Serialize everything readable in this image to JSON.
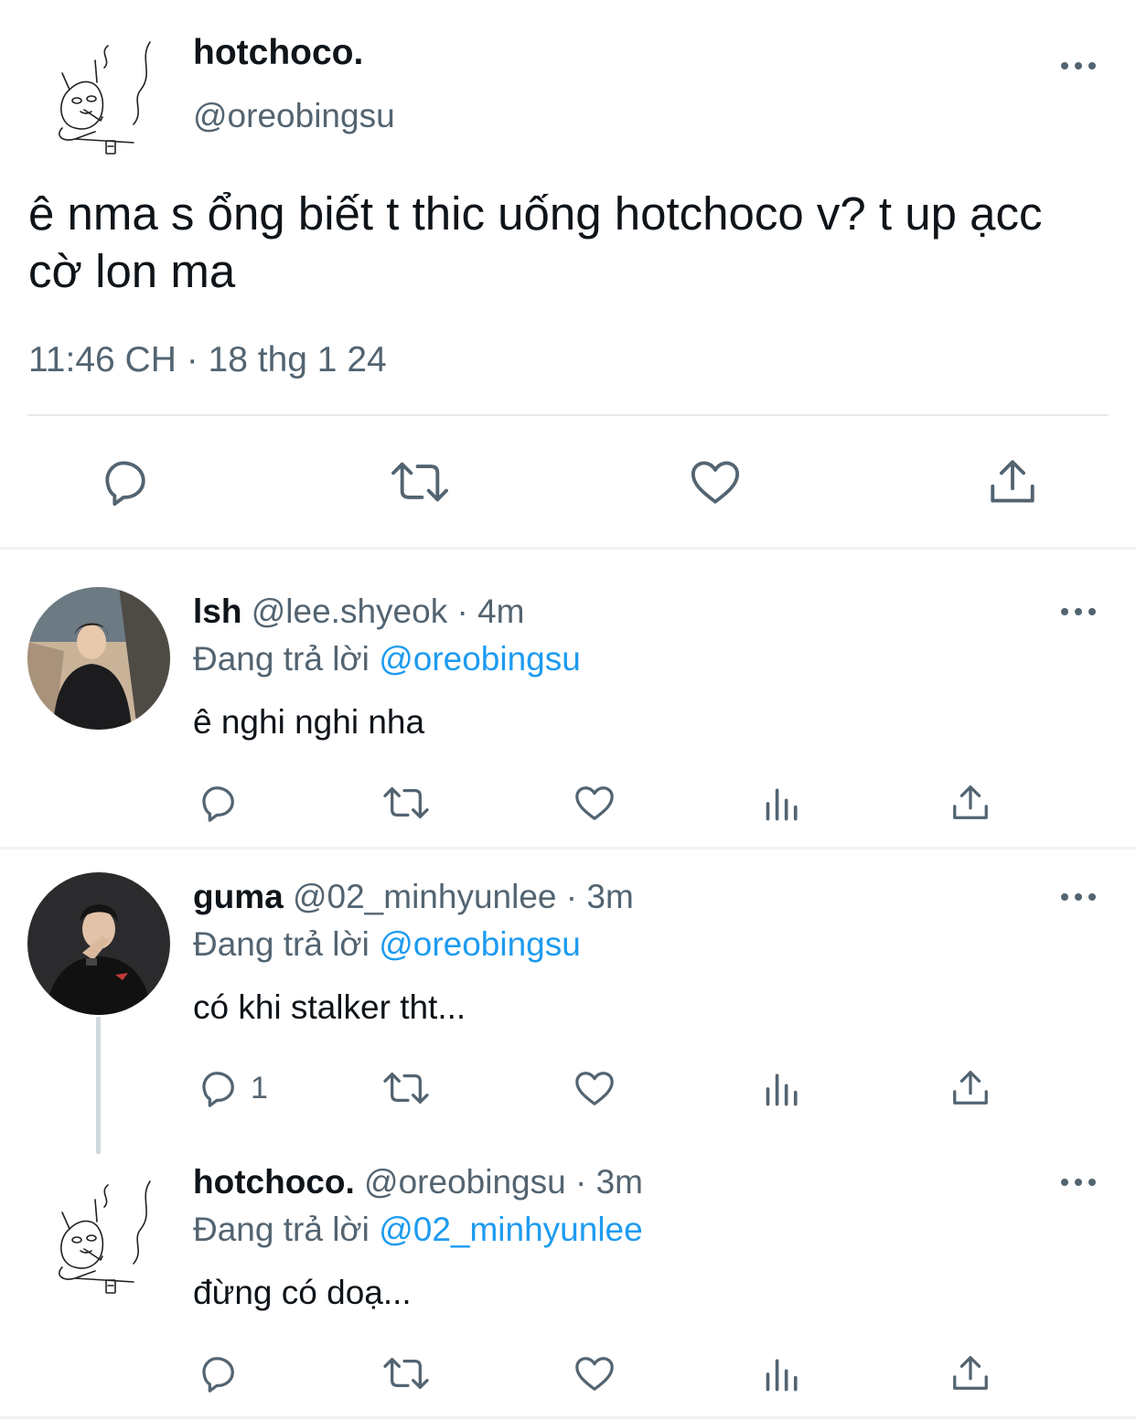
{
  "main_tweet": {
    "name": "hotchoco.",
    "handle": "@oreobingsu",
    "text": "ê nma s ổng biết t thic uống hotchoco v? t up ạcc cờ lon ma",
    "timestamp": "11:46 CH · 18 thg 1 24",
    "actions": [
      "reply-icon",
      "retweet-icon",
      "like-icon",
      "share-icon"
    ]
  },
  "replies": [
    {
      "name": "lsh",
      "meta": "@lee.shyeok · 4m",
      "replying_prefix": "Đang trả lời",
      "replying_to": "@oreobingsu",
      "text": "ê nghi nghi nha",
      "reply_count": ""
    },
    {
      "name": "guma",
      "meta": "@02_minhyunlee · 3m",
      "replying_prefix": "Đang trả lời",
      "replying_to": "@oreobingsu",
      "text": "có khi stalker tht...",
      "reply_count": "1"
    },
    {
      "name": "hotchoco.",
      "meta": "@oreobingsu · 3m",
      "replying_prefix": "Đang trả lời",
      "replying_to": "@02_minhyunlee",
      "text": "đừng có doạ...",
      "reply_count": ""
    }
  ],
  "colors": {
    "text": "#0f1419",
    "secondary": "#536471",
    "mention": "#1d9bf0",
    "divider": "#eff3f4"
  }
}
